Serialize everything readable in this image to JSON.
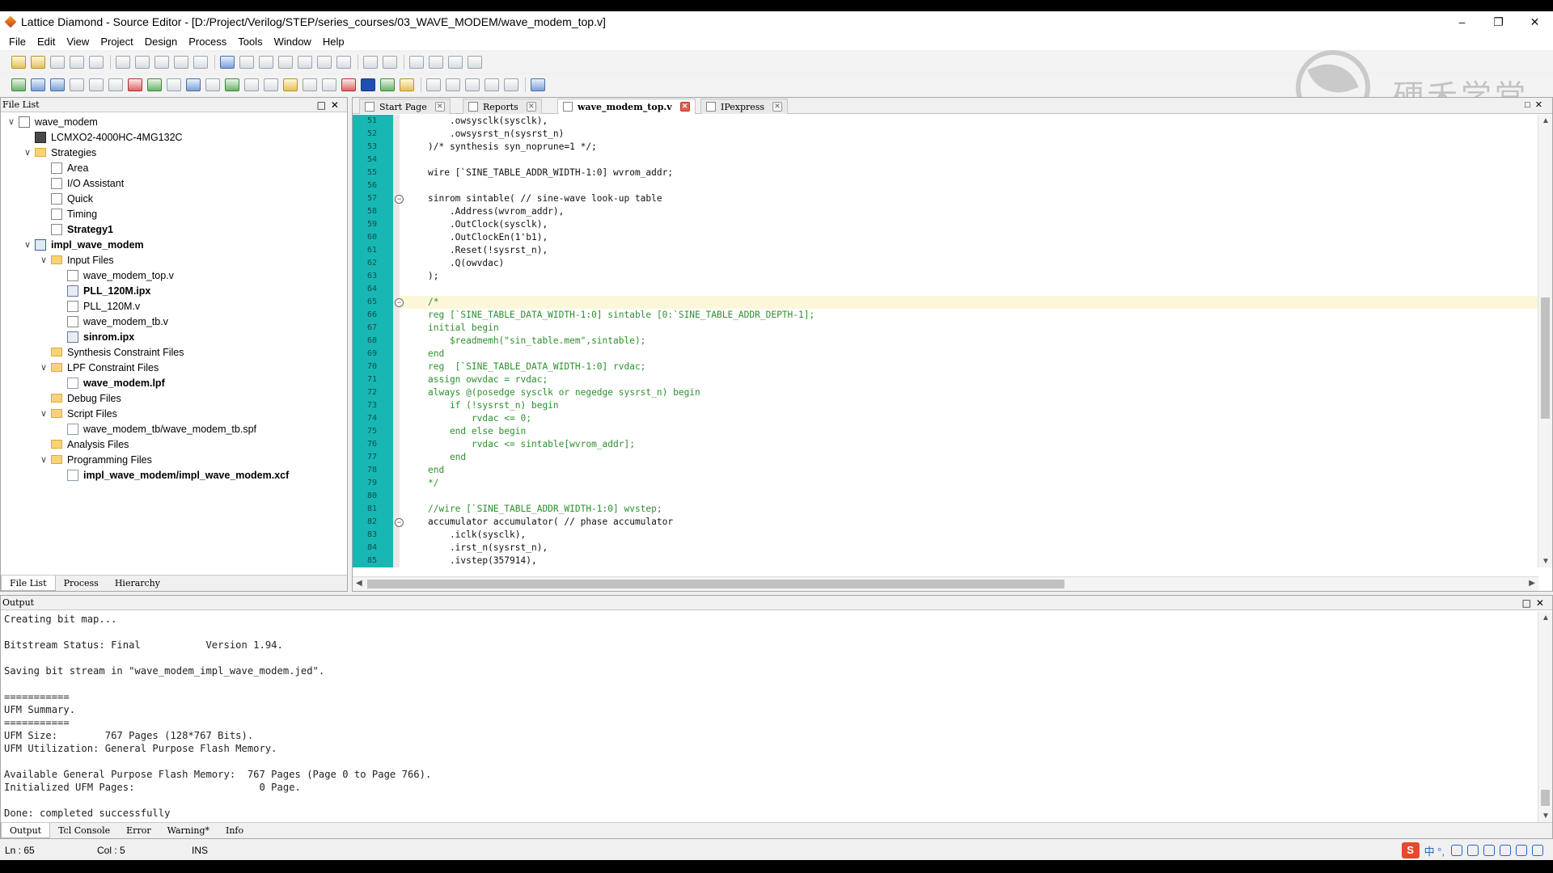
{
  "window": {
    "title": "Lattice Diamond - Source Editor - [D:/Project/Verilog/STEP/series_courses/03_WAVE_MODEM/wave_modem_top.v]",
    "min": "–",
    "max": "❐",
    "close": "✕"
  },
  "menu": [
    "File",
    "Edit",
    "View",
    "Project",
    "Design",
    "Process",
    "Tools",
    "Window",
    "Help"
  ],
  "watermark": {
    "text": "硬禾学堂"
  },
  "file_list": {
    "header": "File List",
    "tree": [
      {
        "label": "wave_modem",
        "bold": false,
        "toggle": "∨",
        "icon": "project-icon"
      },
      {
        "label": "LCMXO2-4000HC-4MG132C",
        "bold": false,
        "toggle": "",
        "icon": "device-icon"
      },
      {
        "label": "Strategies",
        "bold": false,
        "toggle": "∨",
        "icon": "folder-icon"
      },
      {
        "label": "Area",
        "bold": false,
        "toggle": "",
        "icon": "strategy-icon"
      },
      {
        "label": "I/O Assistant",
        "bold": false,
        "toggle": "",
        "icon": "strategy-icon"
      },
      {
        "label": "Quick",
        "bold": false,
        "toggle": "",
        "icon": "strategy-icon"
      },
      {
        "label": "Timing",
        "bold": false,
        "toggle": "",
        "icon": "strategy-icon"
      },
      {
        "label": "Strategy1",
        "bold": true,
        "toggle": "",
        "icon": "strategy-icon"
      },
      {
        "label": "impl_wave_modem",
        "bold": true,
        "toggle": "∨",
        "icon": "implementation-icon"
      },
      {
        "label": "Input Files",
        "bold": false,
        "toggle": "∨",
        "icon": "folder-icon"
      },
      {
        "label": "wave_modem_top.v",
        "bold": false,
        "toggle": "",
        "icon": "verilog-file-icon"
      },
      {
        "label": "PLL_120M.ipx",
        "bold": true,
        "toggle": "",
        "icon": "ipx-file-icon"
      },
      {
        "label": "PLL_120M.v",
        "bold": false,
        "toggle": "",
        "icon": "verilog-file-icon"
      },
      {
        "label": "wave_modem_tb.v",
        "bold": false,
        "toggle": "",
        "icon": "verilog-file-icon"
      },
      {
        "label": "sinrom.ipx",
        "bold": true,
        "toggle": "",
        "icon": "ipx-file-icon"
      },
      {
        "label": "Synthesis Constraint Files",
        "bold": false,
        "toggle": "",
        "icon": "folder-icon"
      },
      {
        "label": "LPF Constraint Files",
        "bold": false,
        "toggle": "∨",
        "icon": "folder-icon"
      },
      {
        "label": "wave_modem.lpf",
        "bold": true,
        "toggle": "",
        "icon": "document-icon"
      },
      {
        "label": "Debug Files",
        "bold": false,
        "toggle": "",
        "icon": "folder-icon"
      },
      {
        "label": "Script Files",
        "bold": false,
        "toggle": "∨",
        "icon": "folder-icon"
      },
      {
        "label": "wave_modem_tb/wave_modem_tb.spf",
        "bold": false,
        "toggle": "",
        "icon": "document-icon"
      },
      {
        "label": "Analysis Files",
        "bold": false,
        "toggle": "",
        "icon": "folder-icon"
      },
      {
        "label": "Programming Files",
        "bold": false,
        "toggle": "∨",
        "icon": "folder-icon"
      },
      {
        "label": "impl_wave_modem/impl_wave_modem.xcf",
        "bold": true,
        "toggle": "",
        "icon": "document-icon"
      }
    ],
    "tabs": [
      "File List",
      "Process",
      "Hierarchy"
    ]
  },
  "editor": {
    "tabs": [
      {
        "label": "Start Page",
        "active": false
      },
      {
        "label": "Reports",
        "active": false
      },
      {
        "label": "wave_modem_top.v",
        "active": true
      },
      {
        "label": "IPexpress",
        "active": false
      }
    ],
    "lines": [
      {
        "n": "51",
        "t": "    .owsysclk(sysclk),",
        "k": ""
      },
      {
        "n": "52",
        "t": "    .owsysrst_n(sysrst_n)",
        "k": ""
      },
      {
        "n": "53",
        "t": ")/* synthesis syn_noprune=1 */;",
        "k": ""
      },
      {
        "n": "54",
        "t": "",
        "k": ""
      },
      {
        "n": "55",
        "t": "wire [`SINE_TABLE_ADDR_WIDTH-1:0] wvrom_addr;",
        "k": ""
      },
      {
        "n": "56",
        "t": "",
        "k": ""
      },
      {
        "n": "57",
        "t": "sinrom sintable( // sine-wave look-up table",
        "k": ""
      },
      {
        "n": "58",
        "t": "    .Address(wvrom_addr),",
        "k": ""
      },
      {
        "n": "59",
        "t": "    .OutClock(sysclk),",
        "k": ""
      },
      {
        "n": "60",
        "t": "    .OutClockEn(1'b1),",
        "k": ""
      },
      {
        "n": "61",
        "t": "    .Reset(!sysrst_n),",
        "k": ""
      },
      {
        "n": "62",
        "t": "    .Q(owvdac)",
        "k": ""
      },
      {
        "n": "63",
        "t": ");",
        "k": ""
      },
      {
        "n": "64",
        "t": "",
        "k": ""
      },
      {
        "n": "65",
        "t": "/*",
        "k": "cm"
      },
      {
        "n": "66",
        "t": "reg [`SINE_TABLE_DATA_WIDTH-1:0] sintable [0:`SINE_TABLE_ADDR_DEPTH-1];",
        "k": "cm"
      },
      {
        "n": "67",
        "t": "initial begin",
        "k": "cm"
      },
      {
        "n": "68",
        "t": "    $readmemh(\"sin_table.mem\",sintable);",
        "k": "cm"
      },
      {
        "n": "69",
        "t": "end",
        "k": "cm"
      },
      {
        "n": "70",
        "t": "reg  [`SINE_TABLE_DATA_WIDTH-1:0] rvdac;",
        "k": "cm"
      },
      {
        "n": "71",
        "t": "assign owvdac = rvdac;",
        "k": "cm"
      },
      {
        "n": "72",
        "t": "always @(posedge sysclk or negedge sysrst_n) begin",
        "k": "cm"
      },
      {
        "n": "73",
        "t": "    if (!sysrst_n) begin",
        "k": "cm"
      },
      {
        "n": "74",
        "t": "        rvdac <= 0;",
        "k": "cm"
      },
      {
        "n": "75",
        "t": "    end else begin",
        "k": "cm"
      },
      {
        "n": "76",
        "t": "        rvdac <= sintable[wvrom_addr];",
        "k": "cm"
      },
      {
        "n": "77",
        "t": "    end",
        "k": "cm"
      },
      {
        "n": "78",
        "t": "end",
        "k": "cm"
      },
      {
        "n": "79",
        "t": "*/",
        "k": "cm"
      },
      {
        "n": "80",
        "t": "",
        "k": ""
      },
      {
        "n": "81",
        "t": "//wire [`SINE_TABLE_ADDR_WIDTH-1:0] wvstep;",
        "k": "cm"
      },
      {
        "n": "82",
        "t": "accumulator accumulator( // phase accumulator",
        "k": ""
      },
      {
        "n": "83",
        "t": "    .iclk(sysclk),",
        "k": ""
      },
      {
        "n": "84",
        "t": "    .irst_n(sysrst_n),",
        "k": ""
      },
      {
        "n": "85",
        "t": "    .ivstep(357914),",
        "k": ""
      }
    ]
  },
  "output": {
    "header": "Output",
    "lines": [
      "Creating bit map...",
      "",
      "Bitstream Status: Final           Version 1.94.",
      "",
      "Saving bit stream in \"wave_modem_impl_wave_modem.jed\".",
      "",
      "===========",
      "UFM Summary.",
      "===========",
      "UFM Size:        767 Pages (128*767 Bits).",
      "UFM Utilization: General Purpose Flash Memory.",
      "",
      "Available General Purpose Flash Memory:  767 Pages (Page 0 to Page 766).",
      "Initialized UFM Pages:                     0 Page.",
      "",
      "Done: completed successfully"
    ],
    "tabs": [
      "Output",
      "Tcl Console",
      "Error",
      "Warning*",
      "Info"
    ]
  },
  "status": {
    "ln": "Ln : 65",
    "col": "Col : 5",
    "mode": "INS",
    "ime_logo": "S",
    "ime_text": "中 °,"
  }
}
